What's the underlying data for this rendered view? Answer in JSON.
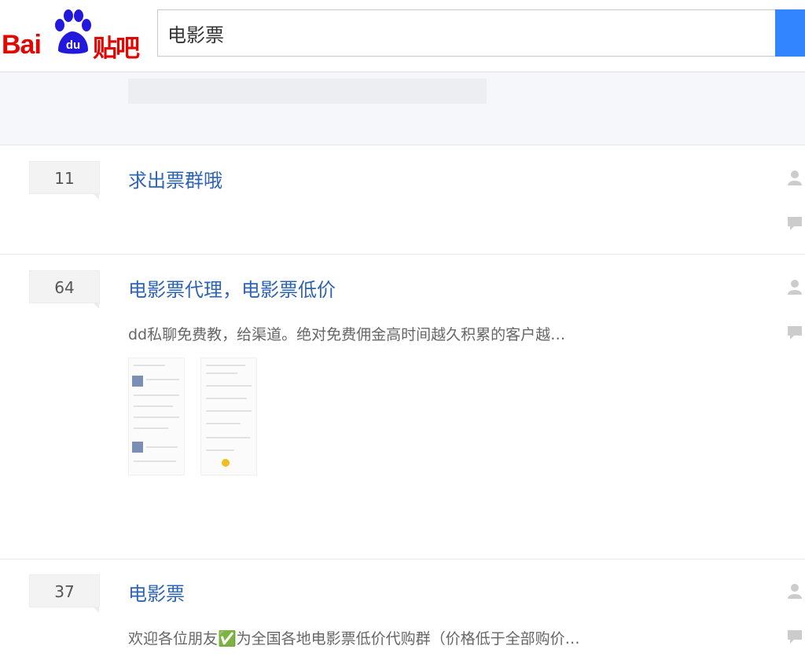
{
  "header": {
    "logo_text_bai": "Bai",
    "logo_text_du": "du",
    "logo_text_tieba": "贴吧",
    "search_value": "电影票",
    "brand_color": "#e10602",
    "search_button_color": "#3385ff"
  },
  "threads": [
    {
      "reply_count": "11",
      "title": "求出票群哦",
      "summary": ""
    },
    {
      "reply_count": "64",
      "title": "电影票代理，电影票低价",
      "summary": "dd私聊免费教，给渠道。绝对免费佣金高时间越久积累的客户越…"
    },
    {
      "reply_count": "37",
      "title": "电影票",
      "summary": "欢迎各位朋友✅为全国各地电影票低价代购群（价格低于全部购价…"
    }
  ],
  "icons": {
    "author": "user-icon",
    "reply": "comment-icon"
  },
  "colors": {
    "title_link": "#2d64b3",
    "reply_badge_bg": "#f3f3f3"
  }
}
